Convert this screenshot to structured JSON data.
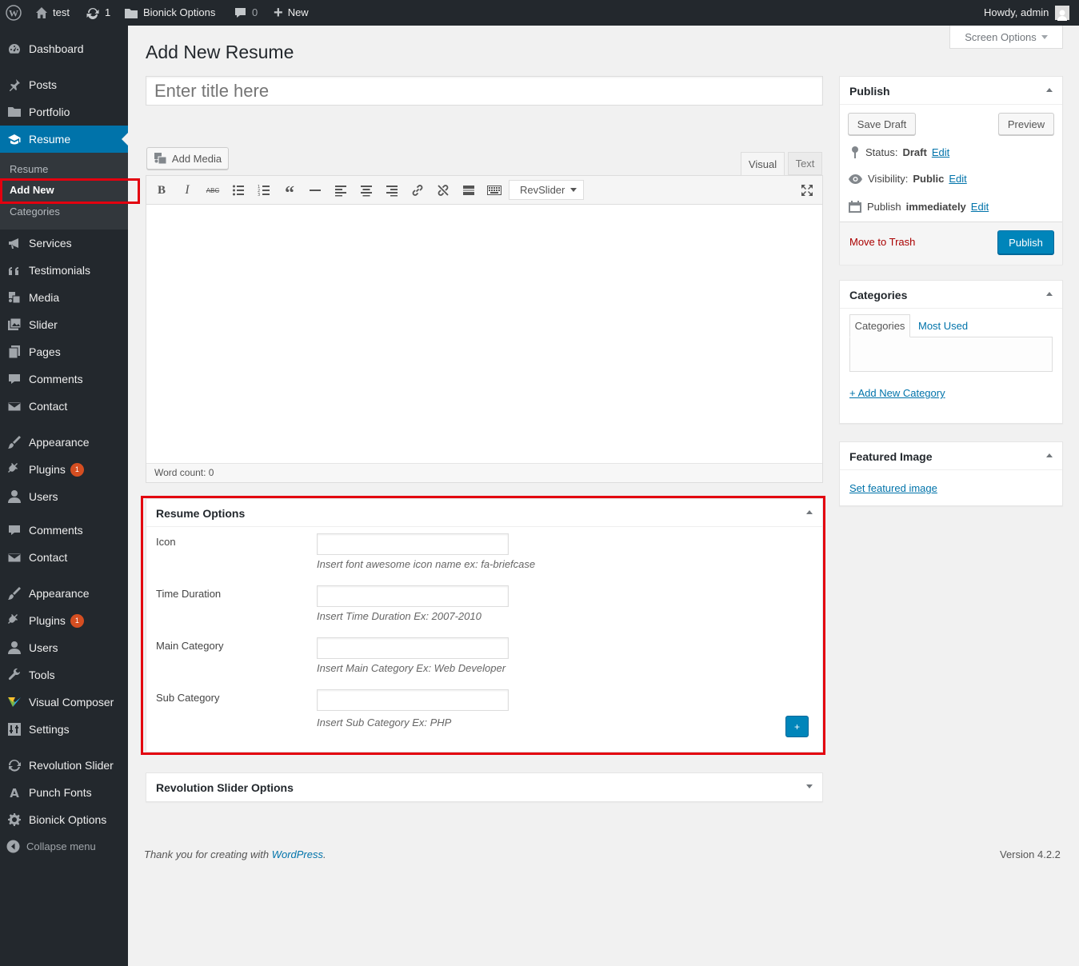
{
  "adminbar": {
    "site_name": "test",
    "updates_count": "1",
    "theme_options": "Bionick Options",
    "comments_count": "0",
    "new_label": "New",
    "howdy": "Howdy, admin"
  },
  "sidebar": {
    "items": [
      {
        "label": "Dashboard",
        "icon": "dashboard-icon"
      },
      {
        "label": "Posts",
        "icon": "pin-icon"
      },
      {
        "label": "Portfolio",
        "icon": "folder-icon"
      },
      {
        "label": "Resume",
        "icon": "graduation-cap-icon"
      },
      {
        "label": "Services",
        "icon": "megaphone-icon"
      },
      {
        "label": "Testimonials",
        "icon": "quote-icon"
      },
      {
        "label": "Media",
        "icon": "media-icon"
      },
      {
        "label": "Slider",
        "icon": "images-icon"
      },
      {
        "label": "Pages",
        "icon": "pages-icon"
      },
      {
        "label": "Comments",
        "icon": "comment-icon"
      },
      {
        "label": "Contact",
        "icon": "envelope-icon"
      },
      {
        "label": "Appearance",
        "icon": "brush-icon"
      },
      {
        "label": "Plugins",
        "icon": "plug-icon",
        "badge": "1"
      },
      {
        "label": "Users",
        "icon": "user-icon"
      },
      {
        "label": "Comments",
        "icon": "comment-icon"
      },
      {
        "label": "Contact",
        "icon": "envelope-icon"
      },
      {
        "label": "Appearance",
        "icon": "brush-icon"
      },
      {
        "label": "Plugins",
        "icon": "plug-icon",
        "badge": "1"
      },
      {
        "label": "Users",
        "icon": "user-icon"
      },
      {
        "label": "Tools",
        "icon": "wrench-icon"
      },
      {
        "label": "Visual Composer",
        "icon": "vc-icon"
      },
      {
        "label": "Settings",
        "icon": "settings-icon"
      },
      {
        "label": "Revolution Slider",
        "icon": "refresh-icon"
      },
      {
        "label": "Punch Fonts",
        "icon": "font-icon"
      },
      {
        "label": "Bionick Options",
        "icon": "gear-icon"
      }
    ],
    "submenu": [
      "Resume",
      "Add New",
      "Categories"
    ],
    "collapse": "Collapse menu"
  },
  "screen_options": "Screen Options",
  "page_title": "Add New Resume",
  "title_placeholder": "Enter title here",
  "editor": {
    "add_media": "Add Media",
    "tab_visual": "Visual",
    "tab_text": "Text",
    "revslider": "RevSlider",
    "word_count": "Word count: 0"
  },
  "resume_options": {
    "title": "Resume Options",
    "fields": [
      {
        "label": "Icon",
        "desc": "Insert font awesome icon name ex: fa-briefcase"
      },
      {
        "label": "Time Duration",
        "desc": "Insert Time Duration Ex: 2007-2010"
      },
      {
        "label": "Main Category",
        "desc": "Insert Main Category Ex: Web Developer"
      },
      {
        "label": "Sub Category",
        "desc": "Insert Sub Category Ex: PHP"
      }
    ],
    "add_button": "+"
  },
  "revslider_options": "Revolution Slider Options",
  "publish": {
    "title": "Publish",
    "save_draft": "Save Draft",
    "preview": "Preview",
    "status_label": "Status:",
    "status_value": "Draft",
    "visibility_label": "Visibility:",
    "visibility_value": "Public",
    "publish_label": "Publish",
    "publish_value": "immediately",
    "edit": "Edit",
    "trash": "Move to Trash",
    "publish_button": "Publish"
  },
  "categories": {
    "title": "Categories",
    "tab_all": "Categories",
    "tab_used": "Most Used",
    "add_new": "+ Add New Category"
  },
  "featured": {
    "title": "Featured Image",
    "set": "Set featured image"
  },
  "footer": {
    "thanks": "Thank you for creating with ",
    "wp_link": "WordPress",
    "period": ".",
    "version": "Version 4.2.2"
  }
}
